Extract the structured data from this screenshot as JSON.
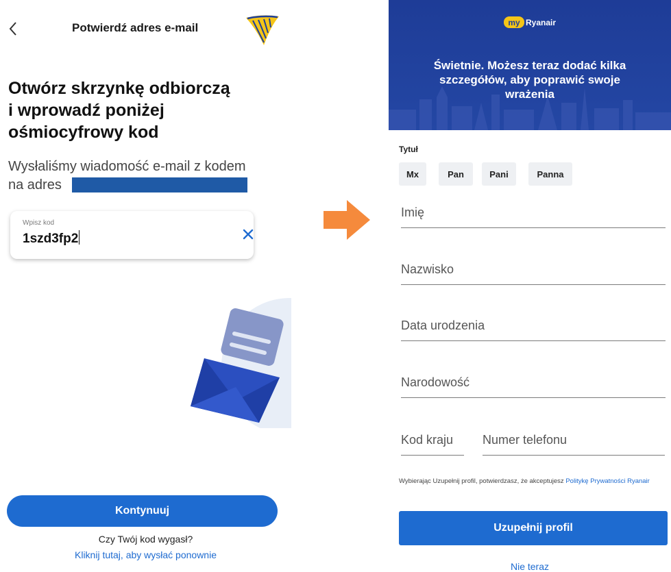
{
  "left_screen": {
    "top_title": "Potwierdź adres e-mail",
    "heading": "Otwórz skrzynkę odbiorczą\ni wprowadź poniżej\nośmiocyfrowy kod",
    "subtext": "Wysłaliśmy wiadomość e-mail z kodem\nna adres",
    "code_field": {
      "label": "Wpisz kod",
      "value": "1szd3fp2"
    },
    "continue_label": "Kontynuuj",
    "expired_question": "Czy Twój kod wygasł?",
    "resend_link": "Kliknij tutaj, aby wysłać ponownie"
  },
  "right_screen": {
    "banner_logo_my": "my",
    "banner_logo_brand": "Ryanair",
    "banner_text": "Świetnie. Możesz teraz dodać kilka\nszczegółów, aby poprawić swoje\nwrażenia",
    "title_label": "Tytuł",
    "title_options": [
      "Mx",
      "Pan",
      "Pani",
      "Panna"
    ],
    "fields": {
      "first_name": "Imię",
      "last_name": "Nazwisko",
      "birth_date": "Data urodzenia",
      "nationality": "Narodowość",
      "country_code": "Kod kraju",
      "phone": "Numer telefonu"
    },
    "consent_text": "Wybierając Uzupełnij profil, potwierdzasz, że akceptujesz",
    "consent_link": "Politykę Prywatności Ryanair",
    "submit_label": "Uzupełnij profil",
    "later_label": "Nie teraz"
  },
  "colors": {
    "primary_blue": "#1e6bd0",
    "banner_blue": "#1f3f9a",
    "arrow_orange": "#f58a3c",
    "redaction": "#1f5aa6",
    "logo_yellow": "#f5c518"
  },
  "icons": [
    "back-chevron-icon",
    "ryanair-harp-logo",
    "clear-x-icon",
    "envelope-illustration",
    "right-arrow-icon"
  ]
}
